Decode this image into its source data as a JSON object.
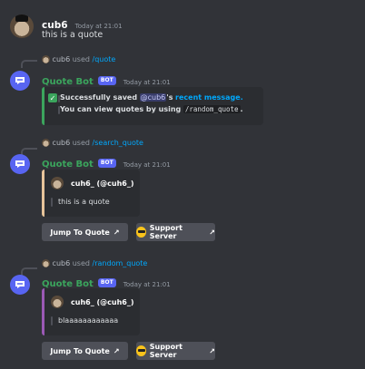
{
  "msg1": {
    "username": "cub6",
    "timestamp": "Today at 21:01",
    "text": "this is a quote"
  },
  "msg2": {
    "reply": {
      "user": "cub6",
      "used": "used",
      "command": "/quote"
    },
    "bot": "Quote Bot",
    "badge": "BOT",
    "timestamp": "Today at 21:01",
    "embed": {
      "line1_pre": "Successfully saved",
      "mention": "@cub6",
      "line1_mid": "'s",
      "link": "recent message.",
      "line2_pre": "You can view quotes by using",
      "code": "/random_quote",
      "line2_post": "."
    }
  },
  "msg3": {
    "reply": {
      "user": "cub6",
      "used": "used",
      "command": "/search_quote"
    },
    "bot": "Quote Bot",
    "badge": "BOT",
    "timestamp": "Today at 21:01",
    "embed": {
      "author": "cuh6_ (@cuh6_)",
      "quote": "this is a quote"
    },
    "buttons": {
      "jump": "Jump To Quote",
      "support": "Support Server"
    }
  },
  "msg4": {
    "reply": {
      "user": "cub6",
      "used": "used",
      "command": "/random_quote"
    },
    "bot": "Quote Bot",
    "badge": "BOT",
    "timestamp": "Today at 21:01",
    "embed": {
      "author": "cuh6_ (@cuh6_)",
      "quote": "blaaaaaaaaaaaa"
    },
    "buttons": {
      "jump": "Jump To Quote",
      "support": "Support Server"
    }
  },
  "colors": {
    "background": "#313338",
    "embed": "#2b2d31",
    "bot_name": "#3ba55d",
    "success_bar": "#3ba55d",
    "search_bar": "#e7c49a",
    "random_bar": "#9b59b6",
    "badge": "#5865f2",
    "link": "#00a8fc",
    "button": "#4e5058"
  },
  "icons": [
    "cat-avatar",
    "bot-avatar-icon",
    "check-icon",
    "external-link-icon",
    "sunglasses-emoji-icon"
  ]
}
